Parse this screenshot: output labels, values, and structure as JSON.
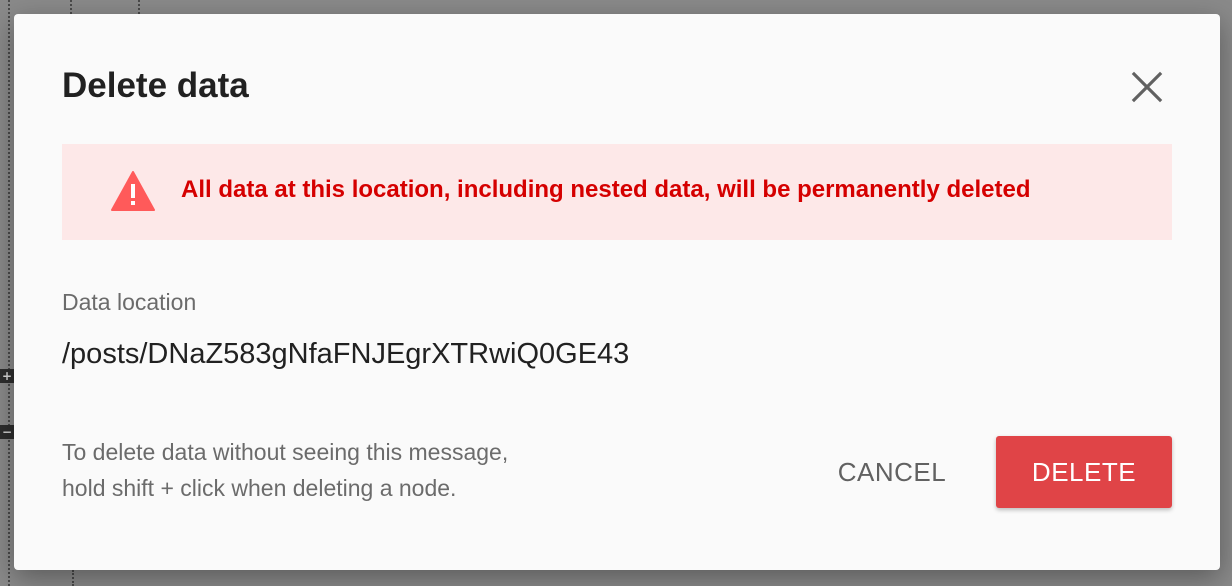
{
  "dialog": {
    "title": "Delete data",
    "close_icon": "close-icon",
    "warning": {
      "icon": "warning-triangle-icon",
      "color": "#d50000",
      "background": "#fde8e8",
      "text": "All data at this location, including nested data, will be permanently deleted"
    },
    "location_label": "Data location",
    "location_value": "/posts/DNaZ583gNfaFNJEgrXTRwiQ0GE43",
    "hint_line1": "To delete data without seeing this message,",
    "hint_line2": "hold shift + click when deleting a node.",
    "cancel_label": "CANCEL",
    "delete_label": "DELETE",
    "delete_color": "#e04447"
  },
  "background": {
    "expand_label": "+",
    "collapse_label": "−"
  }
}
